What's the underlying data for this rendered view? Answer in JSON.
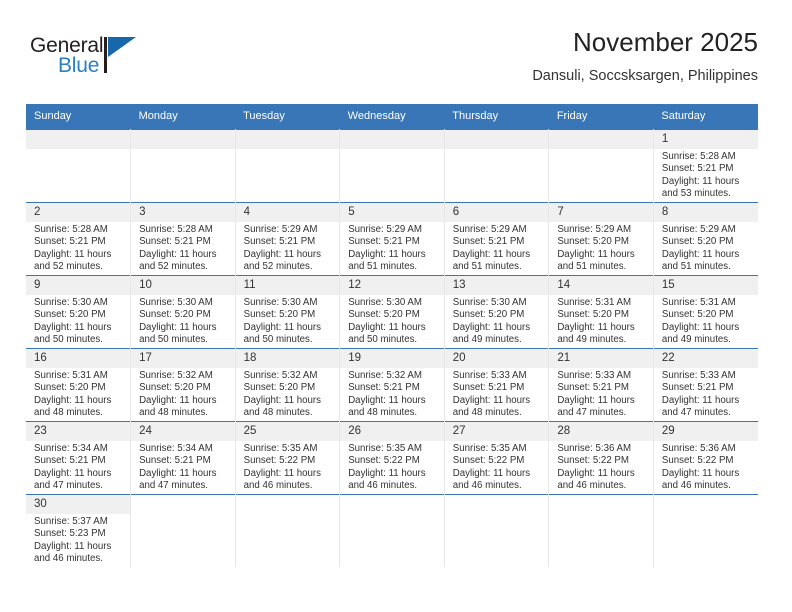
{
  "brand": {
    "name_top": "General",
    "name_bottom": "Blue",
    "accent_color": "#1668ab",
    "triangle_icon": "triangle-icon"
  },
  "header": {
    "title": "November 2025",
    "subtitle": "Dansuli, Soccsksargen, Philippines"
  },
  "calendar": {
    "header_bg": "#3876b8",
    "daynum_bg": "#f0f0f0",
    "weekdays": [
      "Sunday",
      "Monday",
      "Tuesday",
      "Wednesday",
      "Thursday",
      "Friday",
      "Saturday"
    ],
    "weeks": [
      [
        {
          "day": "",
          "empty": true
        },
        {
          "day": "",
          "empty": true
        },
        {
          "day": "",
          "empty": true
        },
        {
          "day": "",
          "empty": true
        },
        {
          "day": "",
          "empty": true
        },
        {
          "day": "",
          "empty": true
        },
        {
          "day": "1",
          "sunrise": "Sunrise: 5:28 AM",
          "sunset": "Sunset: 5:21 PM",
          "daylight1": "Daylight: 11 hours",
          "daylight2": "and 53 minutes."
        }
      ],
      [
        {
          "day": "2",
          "sunrise": "Sunrise: 5:28 AM",
          "sunset": "Sunset: 5:21 PM",
          "daylight1": "Daylight: 11 hours",
          "daylight2": "and 52 minutes."
        },
        {
          "day": "3",
          "sunrise": "Sunrise: 5:28 AM",
          "sunset": "Sunset: 5:21 PM",
          "daylight1": "Daylight: 11 hours",
          "daylight2": "and 52 minutes."
        },
        {
          "day": "4",
          "sunrise": "Sunrise: 5:29 AM",
          "sunset": "Sunset: 5:21 PM",
          "daylight1": "Daylight: 11 hours",
          "daylight2": "and 52 minutes."
        },
        {
          "day": "5",
          "sunrise": "Sunrise: 5:29 AM",
          "sunset": "Sunset: 5:21 PM",
          "daylight1": "Daylight: 11 hours",
          "daylight2": "and 51 minutes."
        },
        {
          "day": "6",
          "sunrise": "Sunrise: 5:29 AM",
          "sunset": "Sunset: 5:21 PM",
          "daylight1": "Daylight: 11 hours",
          "daylight2": "and 51 minutes."
        },
        {
          "day": "7",
          "sunrise": "Sunrise: 5:29 AM",
          "sunset": "Sunset: 5:20 PM",
          "daylight1": "Daylight: 11 hours",
          "daylight2": "and 51 minutes."
        },
        {
          "day": "8",
          "sunrise": "Sunrise: 5:29 AM",
          "sunset": "Sunset: 5:20 PM",
          "daylight1": "Daylight: 11 hours",
          "daylight2": "and 51 minutes."
        }
      ],
      [
        {
          "day": "9",
          "sunrise": "Sunrise: 5:30 AM",
          "sunset": "Sunset: 5:20 PM",
          "daylight1": "Daylight: 11 hours",
          "daylight2": "and 50 minutes."
        },
        {
          "day": "10",
          "sunrise": "Sunrise: 5:30 AM",
          "sunset": "Sunset: 5:20 PM",
          "daylight1": "Daylight: 11 hours",
          "daylight2": "and 50 minutes."
        },
        {
          "day": "11",
          "sunrise": "Sunrise: 5:30 AM",
          "sunset": "Sunset: 5:20 PM",
          "daylight1": "Daylight: 11 hours",
          "daylight2": "and 50 minutes."
        },
        {
          "day": "12",
          "sunrise": "Sunrise: 5:30 AM",
          "sunset": "Sunset: 5:20 PM",
          "daylight1": "Daylight: 11 hours",
          "daylight2": "and 50 minutes."
        },
        {
          "day": "13",
          "sunrise": "Sunrise: 5:30 AM",
          "sunset": "Sunset: 5:20 PM",
          "daylight1": "Daylight: 11 hours",
          "daylight2": "and 49 minutes."
        },
        {
          "day": "14",
          "sunrise": "Sunrise: 5:31 AM",
          "sunset": "Sunset: 5:20 PM",
          "daylight1": "Daylight: 11 hours",
          "daylight2": "and 49 minutes."
        },
        {
          "day": "15",
          "sunrise": "Sunrise: 5:31 AM",
          "sunset": "Sunset: 5:20 PM",
          "daylight1": "Daylight: 11 hours",
          "daylight2": "and 49 minutes."
        }
      ],
      [
        {
          "day": "16",
          "sunrise": "Sunrise: 5:31 AM",
          "sunset": "Sunset: 5:20 PM",
          "daylight1": "Daylight: 11 hours",
          "daylight2": "and 48 minutes."
        },
        {
          "day": "17",
          "sunrise": "Sunrise: 5:32 AM",
          "sunset": "Sunset: 5:20 PM",
          "daylight1": "Daylight: 11 hours",
          "daylight2": "and 48 minutes."
        },
        {
          "day": "18",
          "sunrise": "Sunrise: 5:32 AM",
          "sunset": "Sunset: 5:20 PM",
          "daylight1": "Daylight: 11 hours",
          "daylight2": "and 48 minutes."
        },
        {
          "day": "19",
          "sunrise": "Sunrise: 5:32 AM",
          "sunset": "Sunset: 5:21 PM",
          "daylight1": "Daylight: 11 hours",
          "daylight2": "and 48 minutes."
        },
        {
          "day": "20",
          "sunrise": "Sunrise: 5:33 AM",
          "sunset": "Sunset: 5:21 PM",
          "daylight1": "Daylight: 11 hours",
          "daylight2": "and 48 minutes."
        },
        {
          "day": "21",
          "sunrise": "Sunrise: 5:33 AM",
          "sunset": "Sunset: 5:21 PM",
          "daylight1": "Daylight: 11 hours",
          "daylight2": "and 47 minutes."
        },
        {
          "day": "22",
          "sunrise": "Sunrise: 5:33 AM",
          "sunset": "Sunset: 5:21 PM",
          "daylight1": "Daylight: 11 hours",
          "daylight2": "and 47 minutes."
        }
      ],
      [
        {
          "day": "23",
          "sunrise": "Sunrise: 5:34 AM",
          "sunset": "Sunset: 5:21 PM",
          "daylight1": "Daylight: 11 hours",
          "daylight2": "and 47 minutes."
        },
        {
          "day": "24",
          "sunrise": "Sunrise: 5:34 AM",
          "sunset": "Sunset: 5:21 PM",
          "daylight1": "Daylight: 11 hours",
          "daylight2": "and 47 minutes."
        },
        {
          "day": "25",
          "sunrise": "Sunrise: 5:35 AM",
          "sunset": "Sunset: 5:22 PM",
          "daylight1": "Daylight: 11 hours",
          "daylight2": "and 46 minutes."
        },
        {
          "day": "26",
          "sunrise": "Sunrise: 5:35 AM",
          "sunset": "Sunset: 5:22 PM",
          "daylight1": "Daylight: 11 hours",
          "daylight2": "and 46 minutes."
        },
        {
          "day": "27",
          "sunrise": "Sunrise: 5:35 AM",
          "sunset": "Sunset: 5:22 PM",
          "daylight1": "Daylight: 11 hours",
          "daylight2": "and 46 minutes."
        },
        {
          "day": "28",
          "sunrise": "Sunrise: 5:36 AM",
          "sunset": "Sunset: 5:22 PM",
          "daylight1": "Daylight: 11 hours",
          "daylight2": "and 46 minutes."
        },
        {
          "day": "29",
          "sunrise": "Sunrise: 5:36 AM",
          "sunset": "Sunset: 5:22 PM",
          "daylight1": "Daylight: 11 hours",
          "daylight2": "and 46 minutes."
        }
      ],
      [
        {
          "day": "30",
          "sunrise": "Sunrise: 5:37 AM",
          "sunset": "Sunset: 5:23 PM",
          "daylight1": "Daylight: 11 hours",
          "daylight2": "and 46 minutes."
        },
        {
          "day": "",
          "empty": true,
          "blank": true
        },
        {
          "day": "",
          "empty": true,
          "blank": true
        },
        {
          "day": "",
          "empty": true,
          "blank": true
        },
        {
          "day": "",
          "empty": true,
          "blank": true
        },
        {
          "day": "",
          "empty": true,
          "blank": true
        },
        {
          "day": "",
          "empty": true,
          "blank": true
        }
      ]
    ]
  }
}
